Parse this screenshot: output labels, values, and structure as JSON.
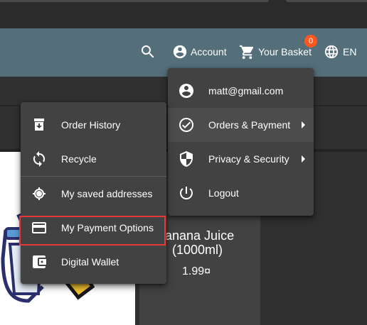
{
  "toolbar": {
    "search_icon": "search-icon",
    "account_label": "Account",
    "basket_label": "Your Basket",
    "basket_count": "0",
    "language_label": "EN"
  },
  "account_menu": {
    "items": [
      {
        "label": "matt@gmail.com",
        "icon": "account-circle-icon"
      },
      {
        "label": "Orders & Payment",
        "icon": "check-circle-icon",
        "submenu": true
      },
      {
        "label": "Privacy & Security",
        "icon": "shield-icon",
        "submenu": true
      },
      {
        "label": "Logout",
        "icon": "power-icon"
      }
    ]
  },
  "orders_menu": {
    "items": [
      {
        "label": "Order History",
        "icon": "archive-icon"
      },
      {
        "label": "Recycle",
        "icon": "recycle-icon"
      },
      {
        "label": "My saved addresses",
        "icon": "location-icon"
      },
      {
        "label": "My Payment Options",
        "icon": "credit-card-icon"
      },
      {
        "label": "Digital Wallet",
        "icon": "wallet-icon"
      }
    ]
  },
  "product": {
    "name_line1": "anana Juice",
    "name_line2": "(1000ml)",
    "price": "1.99¤"
  },
  "colors": {
    "toolbar": "#546e7a",
    "menu": "#424242",
    "badge": "#ff5722",
    "highlight_border": "#e53935"
  }
}
